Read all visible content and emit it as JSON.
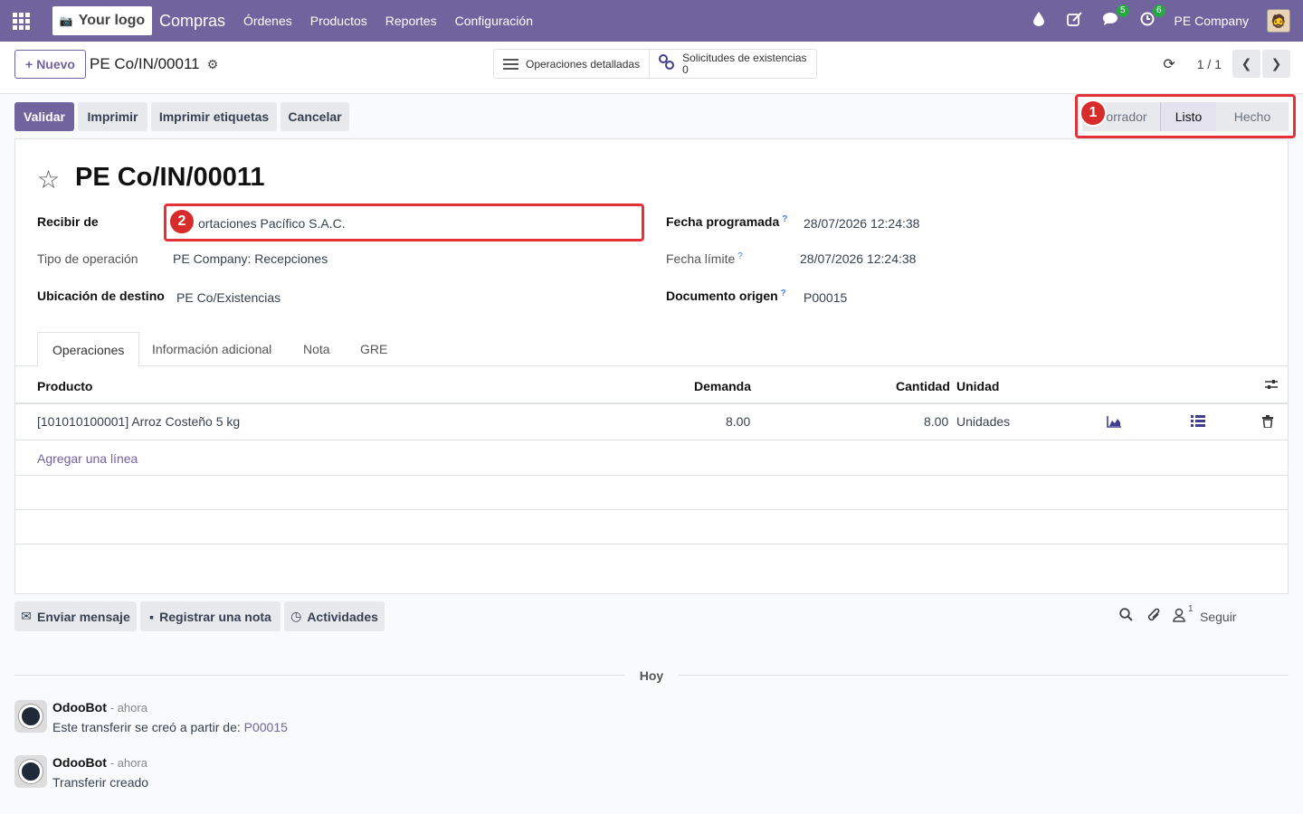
{
  "navbar": {
    "logo_text": "Your logo",
    "app_name": "Compras",
    "menu": [
      "Órdenes",
      "Productos",
      "Reportes",
      "Configuración"
    ],
    "messages_badge": "5",
    "activities_badge": "6",
    "company": "PE Company"
  },
  "control": {
    "new_label": "Nuevo",
    "breadcrumb": "PE Co/IN/00011",
    "smart_detailed_ops": "Operaciones detalladas",
    "smart_stock_requests": "Solicitudes de existencias",
    "smart_stock_requests_count": "0",
    "pager": "1 / 1"
  },
  "actions": {
    "validate": "Validar",
    "print": "Imprimir",
    "print_labels": "Imprimir etiquetas",
    "cancel": "Cancelar"
  },
  "status": {
    "draft": "orrador",
    "ready": "Listo",
    "done": "Hecho",
    "current": "Listo"
  },
  "markers": [
    "1",
    "2"
  ],
  "form": {
    "title": "PE Co/IN/00011",
    "receive_from_label": "Recibir de",
    "receive_from_value": "ortaciones Pacífico S.A.C.",
    "operation_type_label": "Tipo de operación",
    "operation_type_value": "PE Company: Recepciones",
    "dest_location_label": "Ubicación de destino",
    "dest_location_value": "PE Co/Existencias",
    "scheduled_date_label": "Fecha programada",
    "scheduled_date_value": "28/07/2026 12:24:38",
    "deadline_label": "Fecha límite",
    "deadline_value": "28/07/2026 12:24:38",
    "origin_label": "Documento origen",
    "origin_value": "P00015",
    "help_mark": "?"
  },
  "tabs": [
    "Operaciones",
    "Información adicional",
    "Nota",
    "GRE"
  ],
  "table": {
    "headers": {
      "product": "Producto",
      "demand": "Demanda",
      "quantity": "Cantidad",
      "unit": "Unidad"
    },
    "rows": [
      {
        "product": "[101010100001] Arroz Costeño 5 kg",
        "demand": "8.00",
        "quantity": "8.00",
        "unit": "Unidades"
      }
    ],
    "add_line": "Agregar una línea"
  },
  "chatter": {
    "send_message": "Enviar mensaje",
    "log_note": "Registrar una nota",
    "activities": "Actividades",
    "followers_count": "1",
    "follow": "Seguir",
    "date_separator": "Hoy",
    "messages": [
      {
        "author": "OdooBot",
        "time": "- ahora",
        "body": "Este transferir se creó a partir de: ",
        "link": "P00015"
      },
      {
        "author": "OdooBot",
        "time": "- ahora",
        "body": "Transferir creado"
      }
    ]
  }
}
